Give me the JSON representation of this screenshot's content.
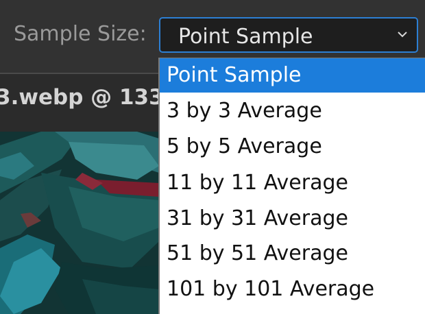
{
  "options_bar": {
    "sample_size_label": "Sample Size:",
    "selected_value": "Point Sample"
  },
  "document_tab": {
    "title": "3.webp @ 133"
  },
  "dropdown": {
    "options": [
      "Point Sample",
      "3 by 3 Average",
      "5 by 5 Average",
      "11 by 11 Average",
      "31 by 31 Average",
      "51 by 51 Average",
      "101 by 101 Average"
    ],
    "selected_index": 0
  },
  "colors": {
    "accent": "#1c7ddb",
    "focus_border": "#2c7fd4",
    "options_bar_bg": "#323232",
    "tab_strip_bg": "#2b2b2b"
  }
}
